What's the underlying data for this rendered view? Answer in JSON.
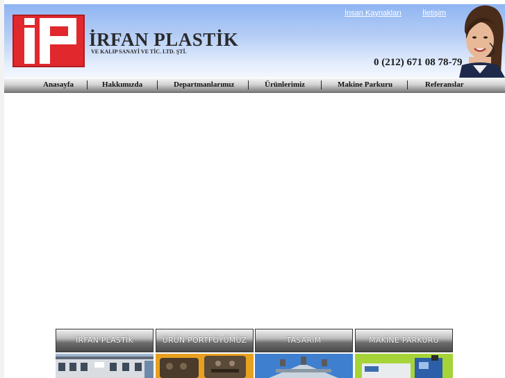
{
  "header": {
    "brand_name": "İRFAN PLASTİK",
    "brand_subtitle": "VE KALIP SANAYİ VE TİC. LTD. ŞTİ.",
    "phone": "0 (212) 671 08 78-79",
    "links": [
      "İnsan Kaynakları",
      "İletişim"
    ]
  },
  "nav": {
    "items": [
      "Anasayfa",
      "Hakkımızda",
      "Departmanlarımız",
      "Ürünlerimiz",
      "Makine Parkuru",
      "Referanslar"
    ]
  },
  "tiles": [
    {
      "label": "İRFAN PLASTİK"
    },
    {
      "label": "ÜRÜN PORTFÖYÜMÜZ"
    },
    {
      "label": "TASARIM"
    },
    {
      "label": "MAKİNE PARKURU"
    }
  ],
  "colors": {
    "logo_red": "#e0282d",
    "header_blue": "#8fb4f2"
  }
}
